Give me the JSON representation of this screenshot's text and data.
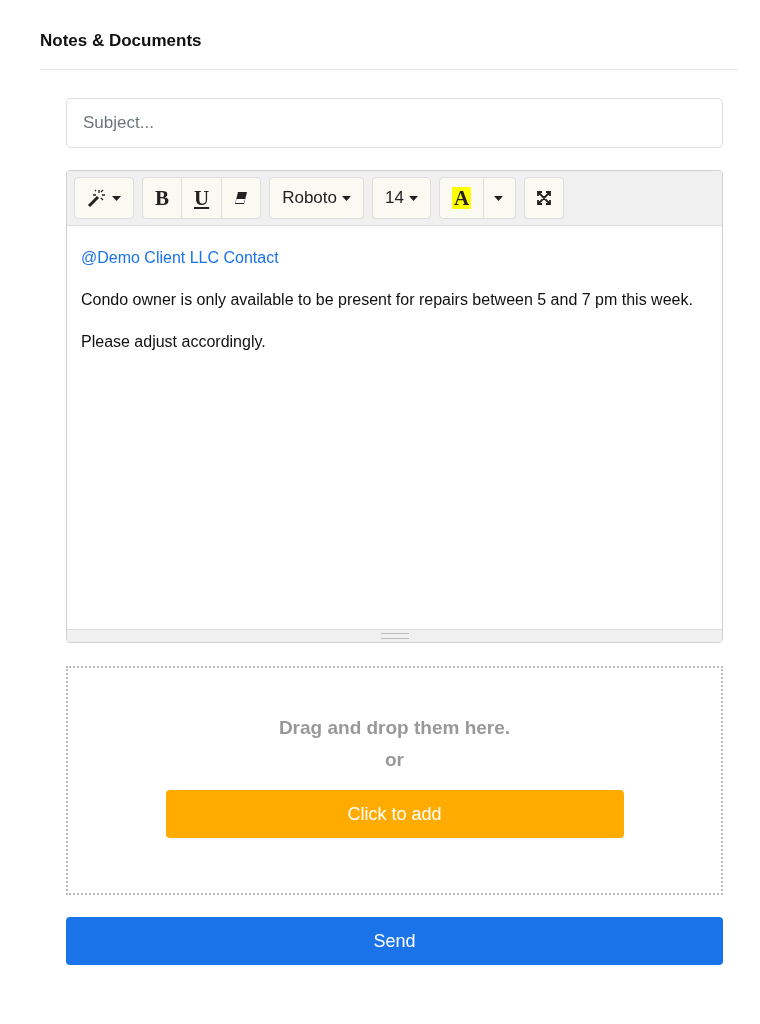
{
  "title": "Notes & Documents",
  "subject": {
    "placeholder": "Subject..."
  },
  "toolbar": [
    {
      "buttons": [
        {
          "kind": "magic"
        }
      ]
    },
    {
      "buttons": [
        {
          "kind": "bold",
          "label": "B"
        },
        {
          "kind": "underline",
          "label": "U"
        },
        {
          "kind": "eraser"
        }
      ]
    },
    {
      "buttons": [
        {
          "kind": "dropdown",
          "label": "Roboto"
        }
      ]
    },
    {
      "buttons": [
        {
          "kind": "dropdown",
          "label": "14"
        }
      ]
    },
    {
      "buttons": [
        {
          "kind": "highlight",
          "label": "A",
          "color": "#ffff00"
        },
        {
          "kind": "caret"
        }
      ]
    },
    {
      "buttons": [
        {
          "kind": "fullscreen"
        }
      ]
    }
  ],
  "editor": {
    "mention": "@Demo Client LLC Contact",
    "paragraphs": [
      "Condo owner is only available to be present for repairs between 5 and 7 pm this week.",
      "Please adjust accordingly."
    ]
  },
  "dropzone": {
    "hint": "Drag and drop them here.",
    "or": "or",
    "button": "Click to add"
  },
  "send": "Send"
}
